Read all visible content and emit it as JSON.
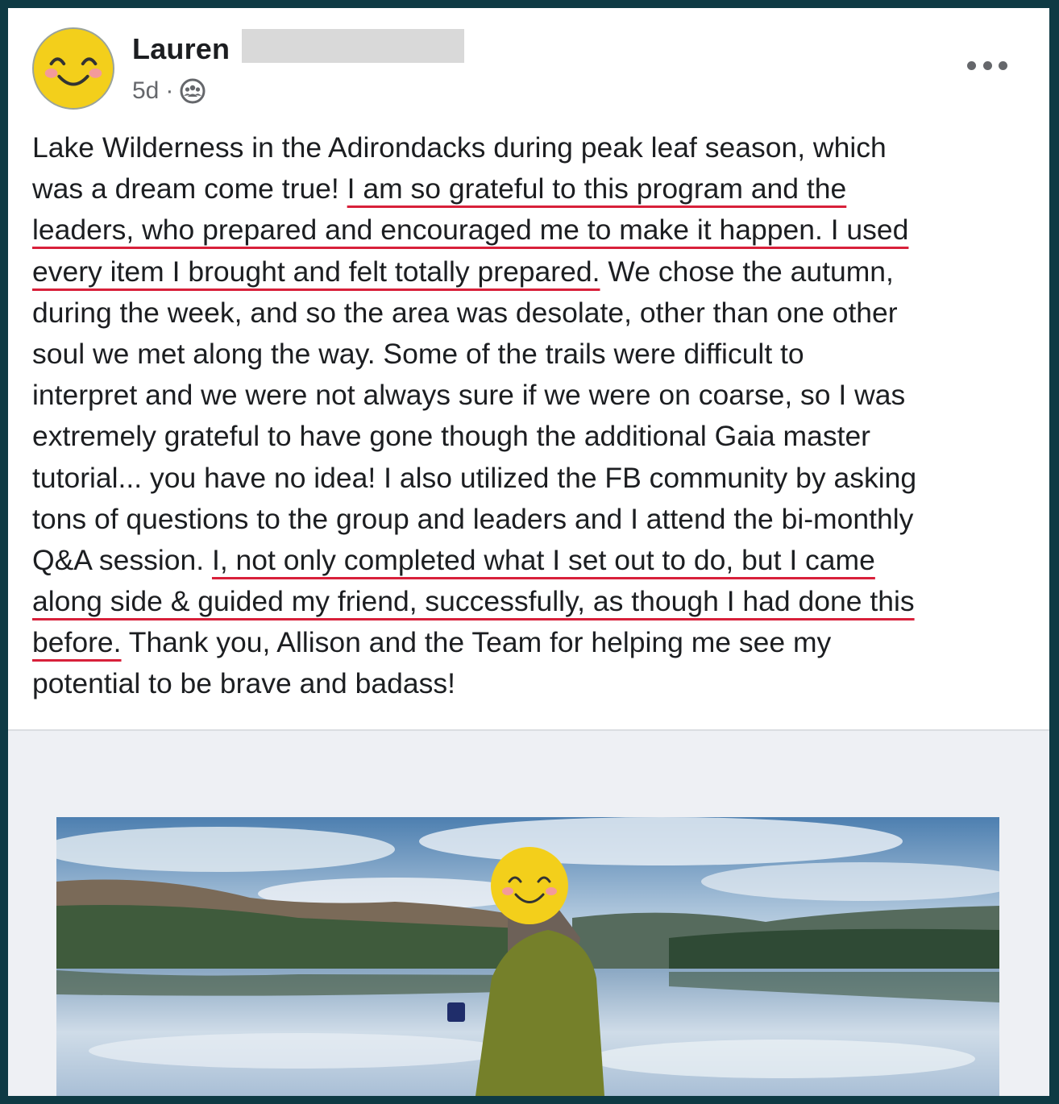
{
  "post": {
    "author_name": "Lauren",
    "timestamp": "5d",
    "separator": "·",
    "audience_icon": "group-icon",
    "more_icon": "more-options-icon",
    "avatar_icon": "smiley-face-icon"
  },
  "body": {
    "l1": "Lake Wilderness in the Adirondacks during peak leaf season, which",
    "l2a": "was a dream come true! ",
    "l2b": "I am so grateful to this program and the",
    "l3": "leaders, who prepared and encouraged me to make it happen. I used",
    "l4a": "every item I brought and felt totally prepared.",
    "l4b": " We chose the autumn,",
    "l5": "during the week, and so the area was desolate, other than one other",
    "l6": "soul we met along the way. Some of the trails were difficult to",
    "l7": "interpret and we were not always sure if we were on coarse, so I was",
    "l8": "extremely grateful to have gone though the additional Gaia master",
    "l9": "tutorial... you have no idea! I also utilized the FB community by asking",
    "l10": "tons of questions to the group and leaders and I attend the bi-monthly",
    "l11a": "Q&A session. ",
    "l11b": "I, not only completed what I set out to do, but I came",
    "l12": "along side & guided my friend, successfully, as though I had done this",
    "l13a": "before.",
    "l13b": " Thank you, Allison and the Team for helping me see my",
    "l14": "potential to be brave and badass!"
  },
  "colors": {
    "underline": "#d8203a",
    "frame": "#0e3a44",
    "text": "#1c1e21",
    "meta": "#65676b"
  }
}
